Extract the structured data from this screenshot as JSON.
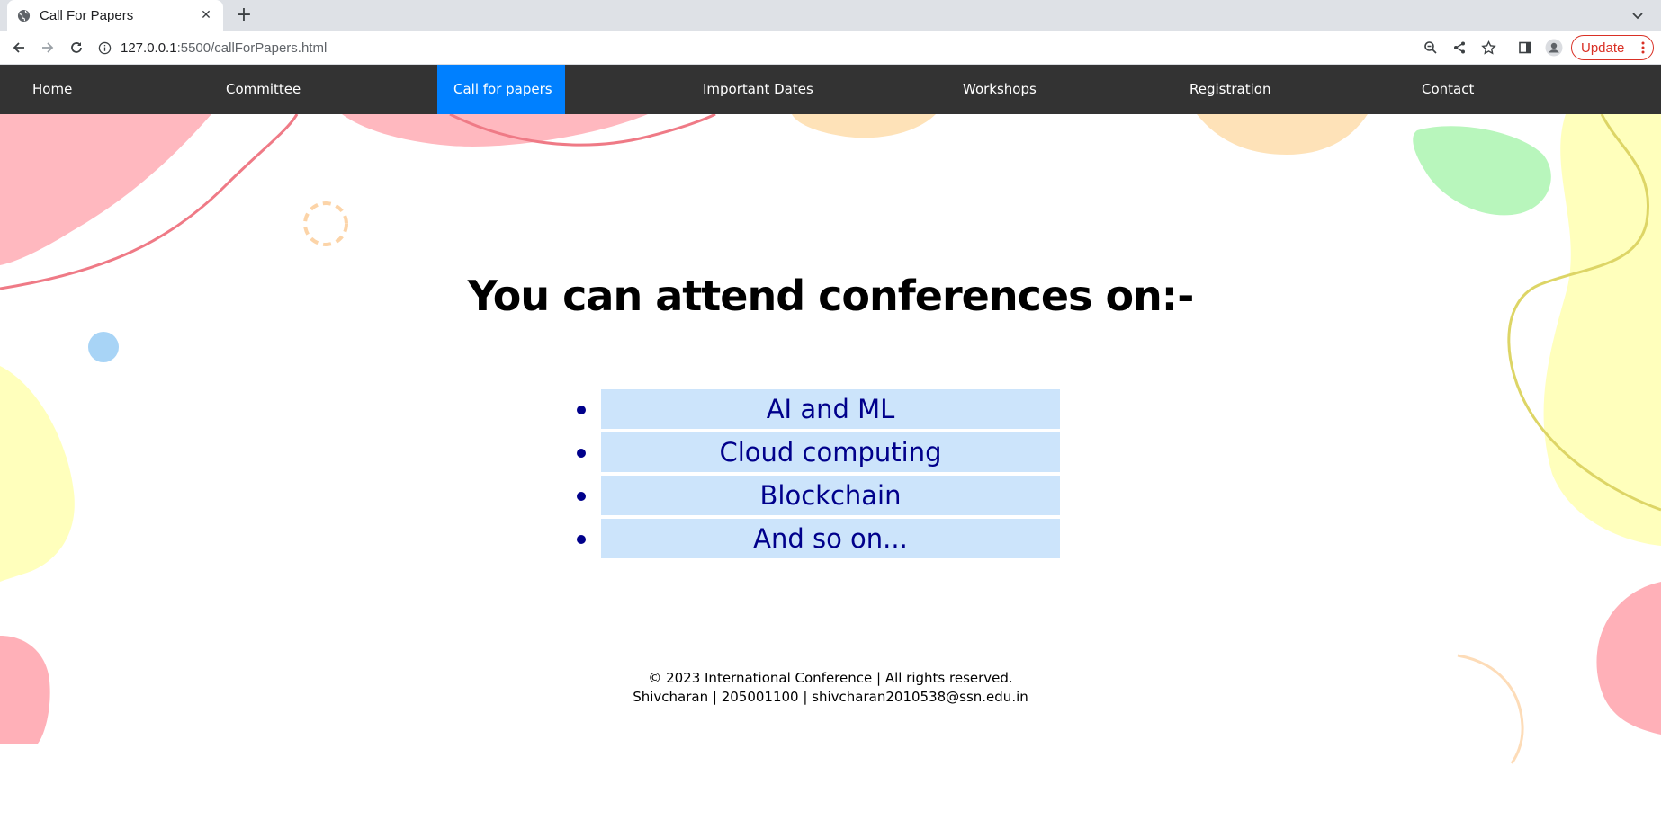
{
  "browser": {
    "tab_title": "Call For Papers",
    "tab_close": "✕",
    "new_tab": "+",
    "url_host": "127.0.0.1",
    "url_rest": ":5500/callForPapers.html",
    "update_label": "Update"
  },
  "nav": {
    "items": [
      {
        "label": "Home"
      },
      {
        "label": "Committee"
      },
      {
        "label": "Call for papers"
      },
      {
        "label": "Important Dates"
      },
      {
        "label": "Workshops"
      },
      {
        "label": "Registration"
      },
      {
        "label": "Contact"
      }
    ],
    "active_index": 2
  },
  "main": {
    "heading": "You can attend conferences on:-",
    "topics": [
      "AI and ML",
      "Cloud computing",
      "Blockchain",
      "And so on..."
    ]
  },
  "footer": {
    "line1": "© 2023 International Conference | All rights reserved.",
    "line2": "Shivcharan | 205001100 | shivcharan2010538@ssn.edu.in"
  },
  "colors": {
    "nav_bg": "#333333",
    "nav_active": "#0080ff",
    "topic_bg": "#cce4fb",
    "topic_text": "#00008b",
    "update_red": "#d93025"
  }
}
